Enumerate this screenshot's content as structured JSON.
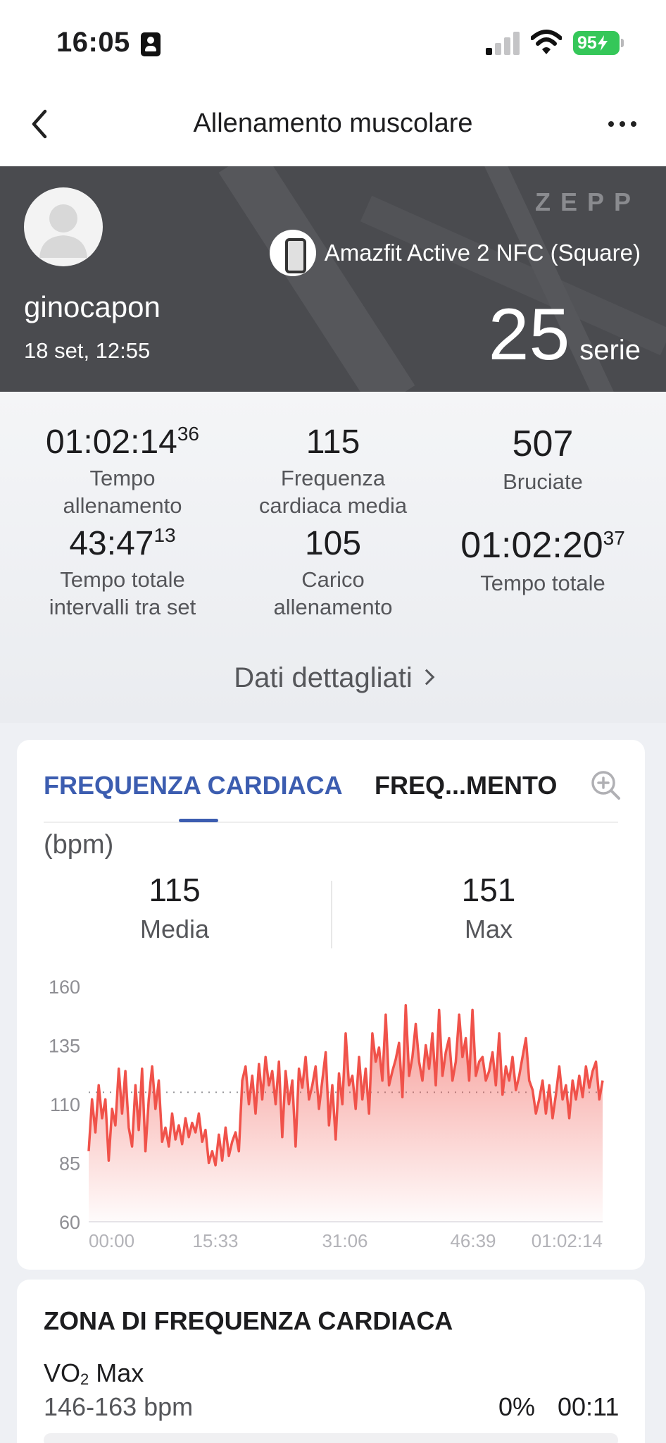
{
  "status_bar": {
    "time": "16:05",
    "battery": "95"
  },
  "nav": {
    "title": "Allenamento muscolare"
  },
  "hero": {
    "brand": "ZEPP",
    "username": "ginocapon",
    "date": "18 set, 12:55",
    "device": "Amazfit Active 2 NFC (Square)",
    "sets_value": "25",
    "sets_unit": "serie"
  },
  "stats": [
    {
      "value": "01:02:14",
      "sup": "36",
      "label": "Tempo allenamento"
    },
    {
      "value": "115",
      "sup": "",
      "label": "Frequenza cardiaca media"
    },
    {
      "value": "507",
      "sup": "",
      "label": "Bruciate"
    },
    {
      "value": "43:47",
      "sup": "13",
      "label": "Tempo totale intervalli tra set"
    },
    {
      "value": "105",
      "sup": "",
      "label": "Carico allenamento"
    },
    {
      "value": "01:02:20",
      "sup": "37",
      "label": "Tempo totale"
    }
  ],
  "detail_link": "Dati dettagliati",
  "hr_card": {
    "tabs": [
      "FREQUENZA CARDIACA",
      "FREQ...MENTO"
    ],
    "unit": "(bpm)",
    "avg_value": "115",
    "avg_label": "Media",
    "max_value": "151",
    "max_label": "Max"
  },
  "chart_data": {
    "type": "area",
    "y_ticks": [
      "160",
      "135",
      "110",
      "85",
      "60"
    ],
    "x_ticks": [
      "00:00",
      "15:33",
      "31:06",
      "46:39",
      "01:02:14"
    ],
    "ylim": [
      60,
      160
    ],
    "average_line": 115,
    "color": "#f0524a",
    "values": [
      90,
      112,
      98,
      118,
      104,
      112,
      86,
      108,
      101,
      125,
      106,
      124,
      100,
      92,
      118,
      99,
      125,
      90,
      112,
      126,
      108,
      120,
      94,
      100,
      92,
      106,
      95,
      101,
      93,
      104,
      96,
      102,
      98,
      106,
      94,
      99,
      85,
      90,
      84,
      97,
      86,
      100,
      88,
      94,
      98,
      90,
      120,
      126,
      110,
      122,
      106,
      127,
      112,
      130,
      118,
      124,
      110,
      128,
      96,
      124,
      110,
      120,
      92,
      125,
      117,
      130,
      112,
      118,
      126,
      108,
      120,
      132,
      101,
      118,
      95,
      123,
      110,
      140,
      118,
      122,
      108,
      130,
      112,
      125,
      106,
      140,
      128,
      134,
      120,
      148,
      118,
      124,
      129,
      136,
      113,
      152,
      122,
      130,
      144,
      128,
      120,
      135,
      125,
      140,
      118,
      150,
      122,
      132,
      138,
      120,
      128,
      148,
      130,
      138,
      120,
      150,
      122,
      128,
      130,
      120,
      124,
      132,
      118,
      140,
      114,
      126,
      120,
      130,
      116,
      122,
      130,
      138,
      120,
      116,
      106,
      112,
      120,
      106,
      118,
      104,
      114,
      126,
      112,
      118,
      104,
      120,
      112,
      122,
      113,
      126,
      117,
      124,
      128,
      112,
      120
    ]
  },
  "zone_card": {
    "title": "ZONA DI FREQUENZA CARDIACA",
    "zone_name": "VO",
    "zone_sub": "2",
    "zone_name_rest": " Max",
    "range": "146-163 bpm",
    "percent": "0%",
    "time": "00:11"
  }
}
